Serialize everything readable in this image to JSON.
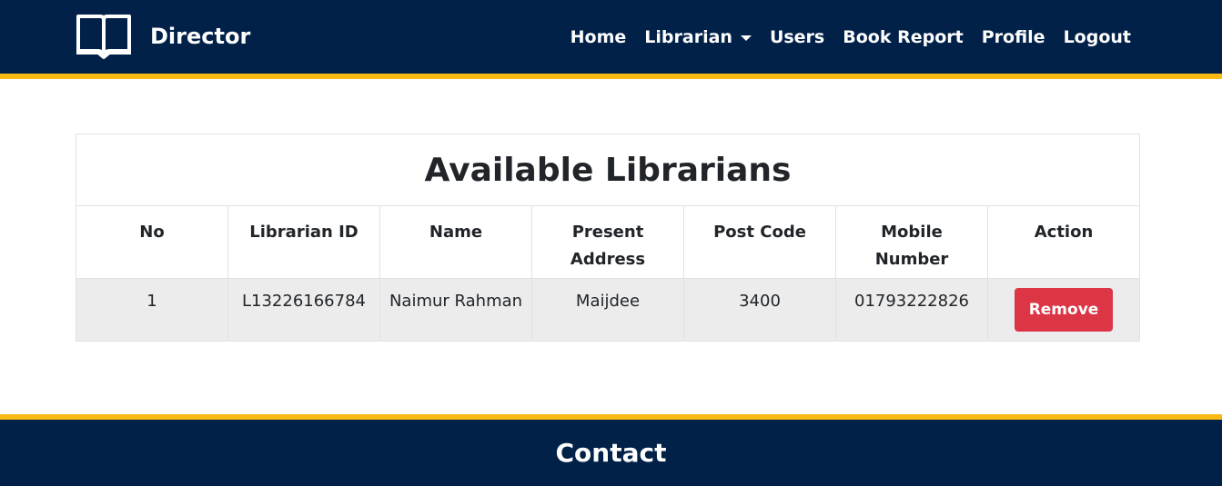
{
  "colors": {
    "nav_bg": "#012148",
    "accent_stripe": "#fdb913",
    "danger": "#dc3545",
    "row_bg": "#ececec"
  },
  "navbar": {
    "brand": {
      "icon": "open-book-icon",
      "label": "Director"
    },
    "links": {
      "home": "Home",
      "librarian": "Librarian",
      "users": "Users",
      "book_report": "Book Report",
      "profile": "Profile",
      "logout": "Logout"
    }
  },
  "table": {
    "title": "Available Librarians",
    "headers": {
      "no": "No",
      "librarian_id": "Librarian ID",
      "name": "Name",
      "present_address_1": "Present",
      "present_address_2": "Address",
      "post_code": "Post Code",
      "mobile_1": "Mobile",
      "mobile_2": "Number",
      "action": "Action"
    },
    "rows": [
      {
        "no": "1",
        "librarian_id": "L13226166784",
        "name": "Naimur Rahman",
        "present_address": "Maijdee",
        "post_code": "3400",
        "mobile_number": "01793222826",
        "action_label": "Remove"
      }
    ]
  },
  "footer": {
    "title": "Contact"
  }
}
